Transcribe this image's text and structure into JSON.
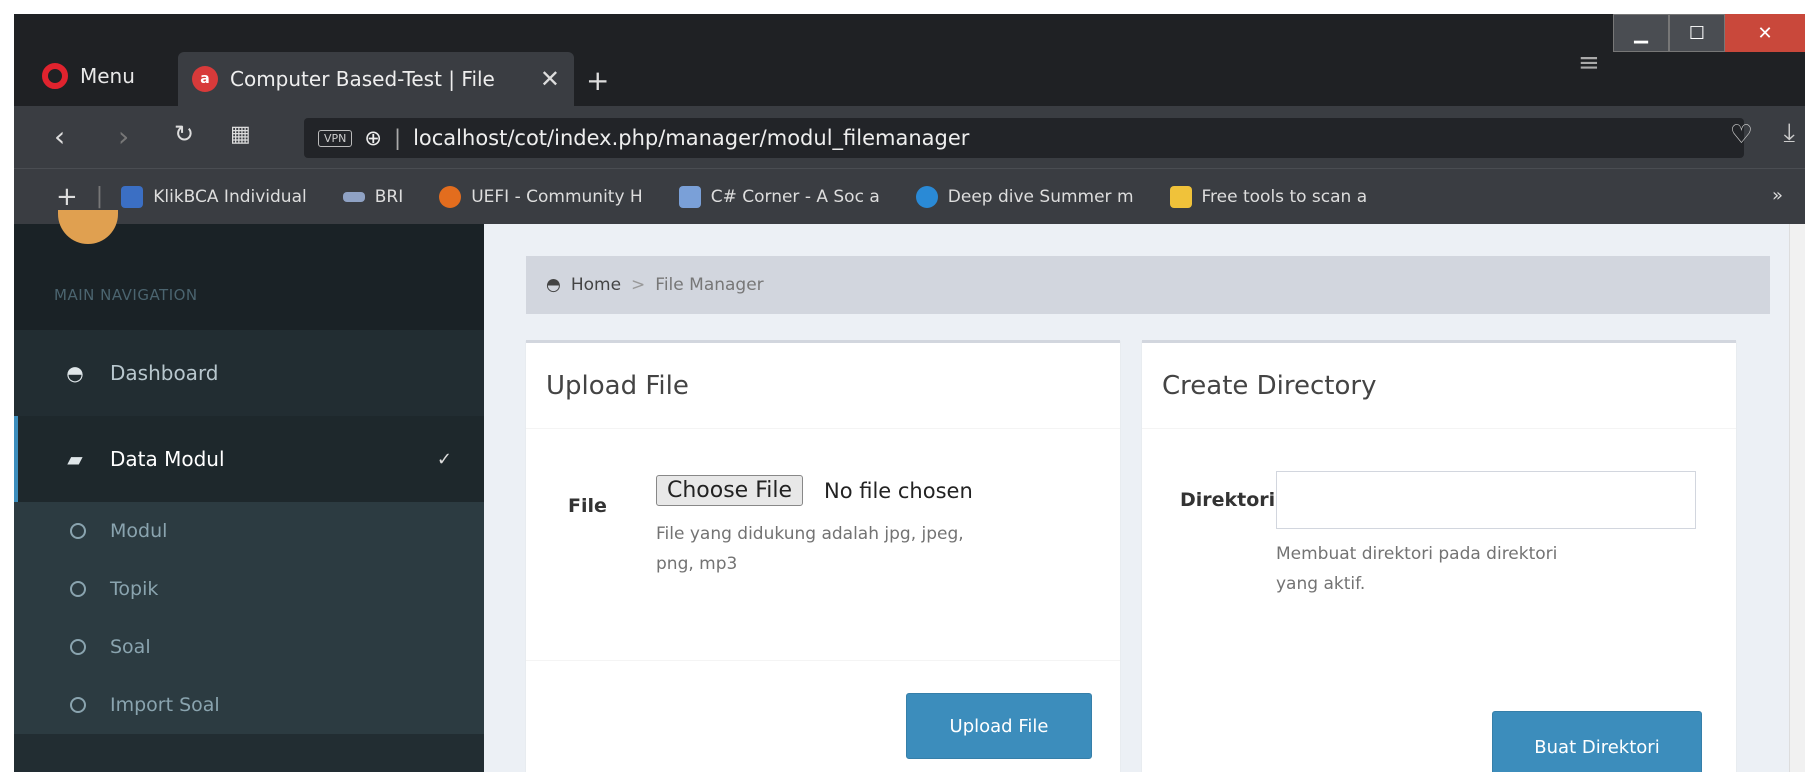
{
  "browser": {
    "menu_label": "Menu",
    "tab_title": "Computer Based-Test | File",
    "url": "localhost/cot/index.php/manager/modul_filemanager",
    "vpn_label": "VPN",
    "bookmarks": [
      {
        "label": "KlikBCA Individual",
        "color": "#3b6fc4"
      },
      {
        "label": "BRI",
        "color": "#8fa2c4"
      },
      {
        "label": "UEFI - Community H",
        "color": "#e36d1e"
      },
      {
        "label": "C# Corner - A Soc a",
        "color": "#7aa0d8"
      },
      {
        "label": "Deep dive Summer m",
        "color": "#2a8ad6"
      },
      {
        "label": "Free tools to scan a",
        "color": "#f0c23a"
      }
    ],
    "more_label": "»"
  },
  "sidebar": {
    "header": "MAIN NAVIGATION",
    "items": [
      {
        "label": "Dashboard",
        "icon": "dashboard-icon"
      },
      {
        "label": "Data Modul",
        "icon": "book-icon"
      }
    ],
    "subitems": [
      "Modul",
      "Topik",
      "Soal",
      "Import Soal"
    ]
  },
  "breadcrumb": {
    "home": "Home",
    "separator": ">",
    "current": "File Manager"
  },
  "upload_box": {
    "title": "Upload File",
    "file_label": "File",
    "choose_button": "Choose File",
    "no_file": "No file chosen",
    "help_line1": "File yang didukung adalah jpg, jpeg,",
    "help_line2": "png, mp3",
    "submit": "Upload File"
  },
  "directory_box": {
    "title": "Create Directory",
    "dir_label": "Direktori",
    "dir_value": "",
    "help_line1": "Membuat direktori pada direktori",
    "help_line2": "yang aktif.",
    "submit": "Buat Direktori"
  }
}
